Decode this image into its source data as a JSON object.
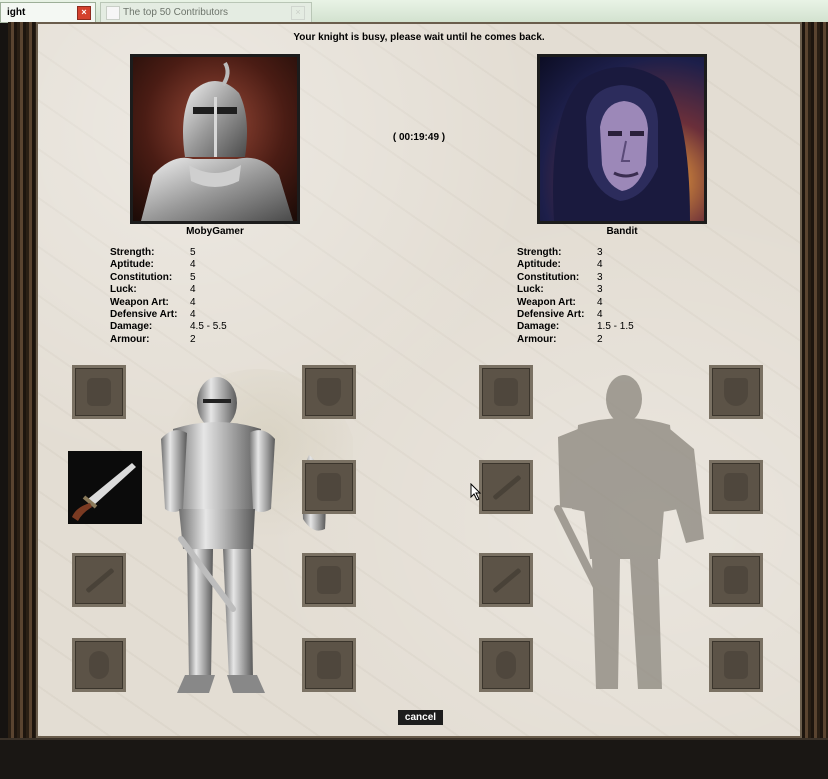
{
  "browser": {
    "tabs": [
      {
        "label": "ight",
        "active": true
      },
      {
        "label": "The top 50 Contributors",
        "active": false
      }
    ]
  },
  "game": {
    "status_message": "Your knight is busy, please wait until he comes back.",
    "timer": "( 00:19:49 )",
    "player": {
      "name": "MobyGamer",
      "stats": [
        {
          "label": "Strength:",
          "value": "5"
        },
        {
          "label": "Aptitude:",
          "value": "4"
        },
        {
          "label": "Constitution:",
          "value": "5"
        },
        {
          "label": "Luck:",
          "value": "4"
        },
        {
          "label": "Weapon Art:",
          "value": "4"
        },
        {
          "label": "Defensive Art:",
          "value": "4"
        },
        {
          "label": "Damage:",
          "value": "4.5 - 5.5"
        },
        {
          "label": "Armour:",
          "value": "2"
        }
      ]
    },
    "opponent": {
      "name": "Bandit",
      "stats": [
        {
          "label": "Strength:",
          "value": "3"
        },
        {
          "label": "Aptitude:",
          "value": "4"
        },
        {
          "label": "Constitution:",
          "value": "3"
        },
        {
          "label": "Luck:",
          "value": "3"
        },
        {
          "label": "Weapon Art:",
          "value": "4"
        },
        {
          "label": "Defensive Art:",
          "value": "4"
        },
        {
          "label": "Damage:",
          "value": "1.5 - 1.5"
        },
        {
          "label": "Armour:",
          "value": "2"
        }
      ]
    },
    "cancel_label": "cancel",
    "colors": {
      "panel_bg": "#e3ddd3",
      "slot_bg": "#5c5347",
      "frame": "#3a2b1d"
    }
  }
}
